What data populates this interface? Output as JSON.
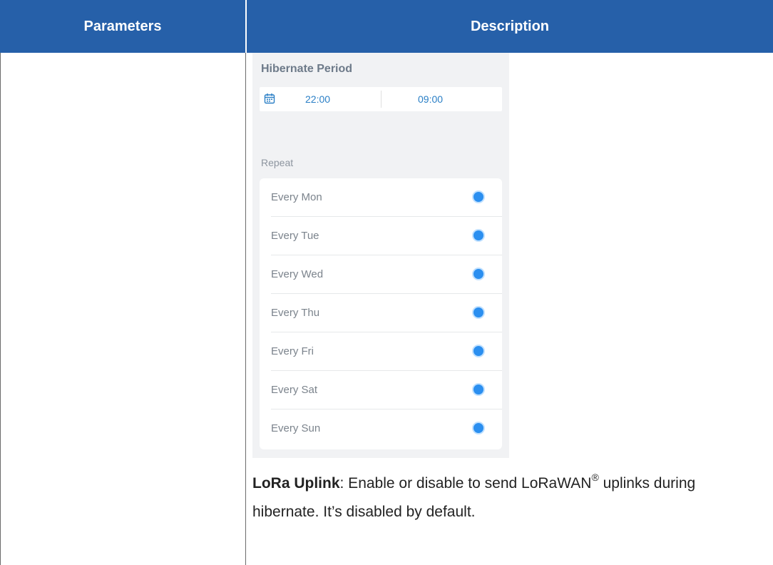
{
  "table": {
    "headers": [
      "Parameters",
      "Description"
    ],
    "header_color": "#2660a9"
  },
  "screenshot": {
    "title": "Hibernate Period",
    "icon": "calendar-icon",
    "start_time": "22:00",
    "end_time": "09:00",
    "repeat_label": "Repeat",
    "days": [
      {
        "label": "Every Mon",
        "selected": true
      },
      {
        "label": "Every Tue",
        "selected": true
      },
      {
        "label": "Every Wed",
        "selected": true
      },
      {
        "label": "Every Thu",
        "selected": true
      },
      {
        "label": "Every Fri",
        "selected": true
      },
      {
        "label": "Every Sat",
        "selected": true
      },
      {
        "label": "Every Sun",
        "selected": true
      }
    ],
    "accent_color": "#2b8ff0"
  },
  "description": {
    "term": "LoRa Uplink",
    "text_before_mark": ": Enable or disable to send LoRaWAN",
    "mark": "®",
    "text_after_mark": " uplinks during hibernate. It’s disabled by default."
  }
}
